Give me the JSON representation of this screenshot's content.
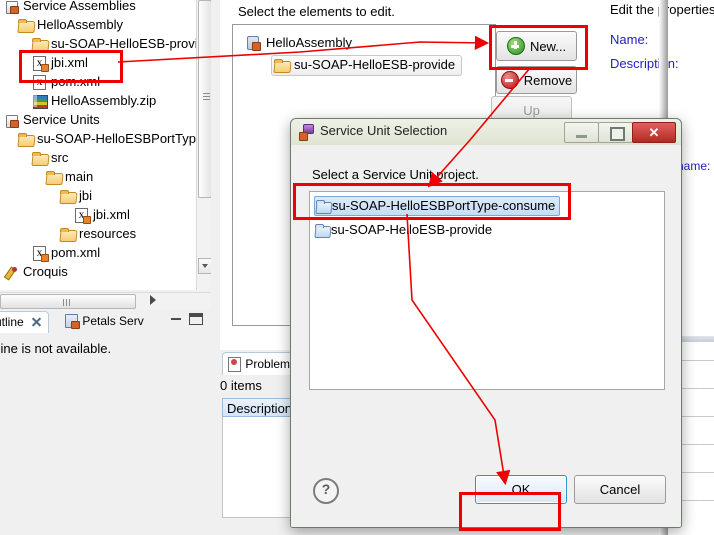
{
  "explorer": {
    "rows": [
      {
        "label": "Service Assemblies",
        "icon": "category-icon",
        "indent": 0,
        "partial_top": true
      },
      {
        "label": "HelloAssembly",
        "icon": "folder-icon",
        "indent": 1
      },
      {
        "label": "su-SOAP-HelloESB-provid",
        "icon": "folder-icon",
        "indent": 2
      },
      {
        "label": "jbi.xml",
        "icon": "xml-file-icon",
        "indent": 2,
        "highlighted": true
      },
      {
        "label": "pom.xml",
        "icon": "xml-file-icon",
        "indent": 2
      },
      {
        "label": "HelloAssembly.zip",
        "icon": "zip-file-icon",
        "indent": 2
      },
      {
        "label": "Service Units",
        "icon": "category-icon",
        "indent": 0
      },
      {
        "label": "su-SOAP-HelloESBPortType-",
        "icon": "folder-icon",
        "indent": 1
      },
      {
        "label": "src",
        "icon": "folder-icon",
        "indent": 2
      },
      {
        "label": "main",
        "icon": "folder-icon",
        "indent": 3
      },
      {
        "label": "jbi",
        "icon": "folder-icon",
        "indent": 4
      },
      {
        "label": "jbi.xml",
        "icon": "xml-file-icon",
        "indent": 5
      },
      {
        "label": "resources",
        "icon": "folder-icon",
        "indent": 4
      },
      {
        "label": "pom.xml",
        "icon": "xml-file-icon",
        "indent": 2
      },
      {
        "label": "Croquis",
        "icon": "croquis-icon",
        "indent": 0
      }
    ]
  },
  "outline_view": {
    "tab_outline_label": "utline",
    "tab_petals_label": "Petals Serv",
    "message": "tline is not available."
  },
  "editor": {
    "hint": "Select the elements to edit.",
    "tree": [
      {
        "label": "HelloAssembly",
        "icon": "service-assembly-icon"
      },
      {
        "label": "su-SOAP-HelloESB-provide",
        "icon": "service-unit-icon"
      }
    ],
    "buttons": {
      "new": "New...",
      "remove": "Remove",
      "up": "Up"
    },
    "properties": {
      "title": "Edit the properties",
      "name_label": "Name:",
      "description_label": "Description:",
      "name_label_right": "name:"
    }
  },
  "problems_view": {
    "tab_label": "Problem",
    "count": "0 items",
    "column_header": "Description"
  },
  "dialog": {
    "title": "Service Unit Selection",
    "prompt": "Select a Service Unit project.",
    "items": [
      {
        "label": "su-SOAP-HelloESBPortType-consume",
        "selected": true
      },
      {
        "label": "su-SOAP-HelloESB-provide",
        "selected": false
      }
    ],
    "help_label": "?",
    "ok_label": "OK",
    "cancel_label": "Cancel",
    "window_controls": {
      "minimize": "",
      "maximize": "",
      "close": "✕"
    }
  },
  "annotations": {
    "highlight_color": "#ee0000",
    "boxes": [
      "jbi.xml",
      "New...",
      "su-SOAP-HelloESBPortType-consume",
      "OK"
    ],
    "arrows": [
      {
        "from": "jbi.xml",
        "to": "New..."
      },
      {
        "from": "New...",
        "to": "su-SOAP-HelloESBPortType-consume"
      },
      {
        "from": "su-SOAP-HelloESBPortType-consume",
        "to": "OK"
      }
    ]
  }
}
